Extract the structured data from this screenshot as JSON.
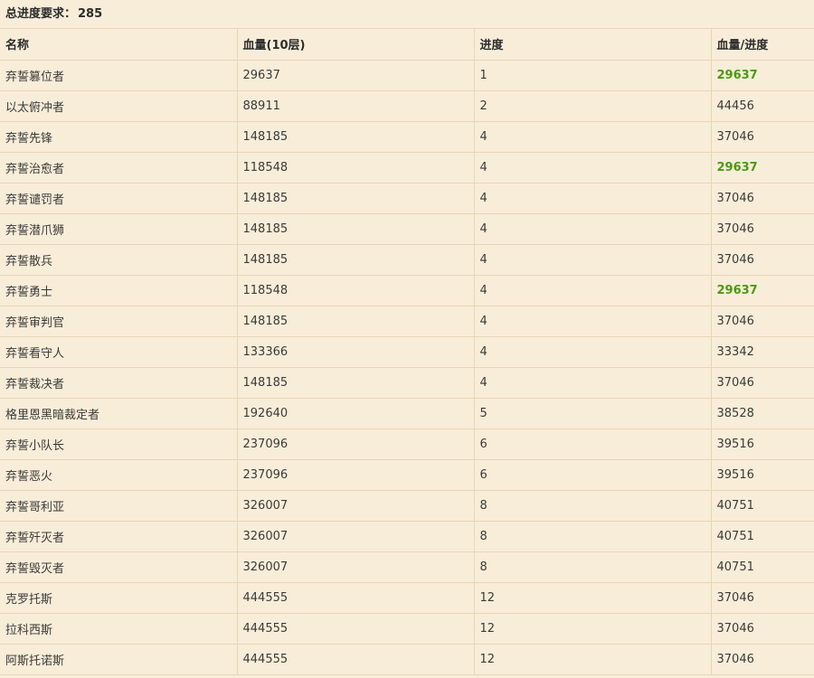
{
  "summary": {
    "label": "总进度要求：",
    "value": "285"
  },
  "table": {
    "headers": [
      "名称",
      "血量(10层)",
      "进度",
      "血量/进度"
    ],
    "highlight_color": "#4a9a13",
    "rows": [
      {
        "name": "弃誓篡位者",
        "hp": "29637",
        "progress": "1",
        "ratio": "29637",
        "best": true
      },
      {
        "name": "以太俯冲者",
        "hp": "88911",
        "progress": "2",
        "ratio": "44456",
        "best": false
      },
      {
        "name": "弃誓先锋",
        "hp": "148185",
        "progress": "4",
        "ratio": "37046",
        "best": false
      },
      {
        "name": "弃誓治愈者",
        "hp": "118548",
        "progress": "4",
        "ratio": "29637",
        "best": true
      },
      {
        "name": "弃誓谴罚者",
        "hp": "148185",
        "progress": "4",
        "ratio": "37046",
        "best": false
      },
      {
        "name": "弃誓潜爪狮",
        "hp": "148185",
        "progress": "4",
        "ratio": "37046",
        "best": false
      },
      {
        "name": "弃誓散兵",
        "hp": "148185",
        "progress": "4",
        "ratio": "37046",
        "best": false
      },
      {
        "name": "弃誓勇士",
        "hp": "118548",
        "progress": "4",
        "ratio": "29637",
        "best": true
      },
      {
        "name": "弃誓审判官",
        "hp": "148185",
        "progress": "4",
        "ratio": "37046",
        "best": false
      },
      {
        "name": "弃誓看守人",
        "hp": "133366",
        "progress": "4",
        "ratio": "33342",
        "best": false
      },
      {
        "name": "弃誓裁决者",
        "hp": "148185",
        "progress": "4",
        "ratio": "37046",
        "best": false
      },
      {
        "name": "格里恩黑暗裁定者",
        "hp": "192640",
        "progress": "5",
        "ratio": "38528",
        "best": false
      },
      {
        "name": "弃誓小队长",
        "hp": "237096",
        "progress": "6",
        "ratio": "39516",
        "best": false
      },
      {
        "name": "弃誓恶火",
        "hp": "237096",
        "progress": "6",
        "ratio": "39516",
        "best": false
      },
      {
        "name": "弃誓哥利亚",
        "hp": "326007",
        "progress": "8",
        "ratio": "40751",
        "best": false
      },
      {
        "name": "弃誓歼灭者",
        "hp": "326007",
        "progress": "8",
        "ratio": "40751",
        "best": false
      },
      {
        "name": "弃誓毁灭者",
        "hp": "326007",
        "progress": "8",
        "ratio": "40751",
        "best": false
      },
      {
        "name": "克罗托斯",
        "hp": "444555",
        "progress": "12",
        "ratio": "37046",
        "best": false
      },
      {
        "name": "拉科西斯",
        "hp": "444555",
        "progress": "12",
        "ratio": "37046",
        "best": false
      },
      {
        "name": "阿斯托诺斯",
        "hp": "444555",
        "progress": "12",
        "ratio": "37046",
        "best": false
      }
    ]
  }
}
